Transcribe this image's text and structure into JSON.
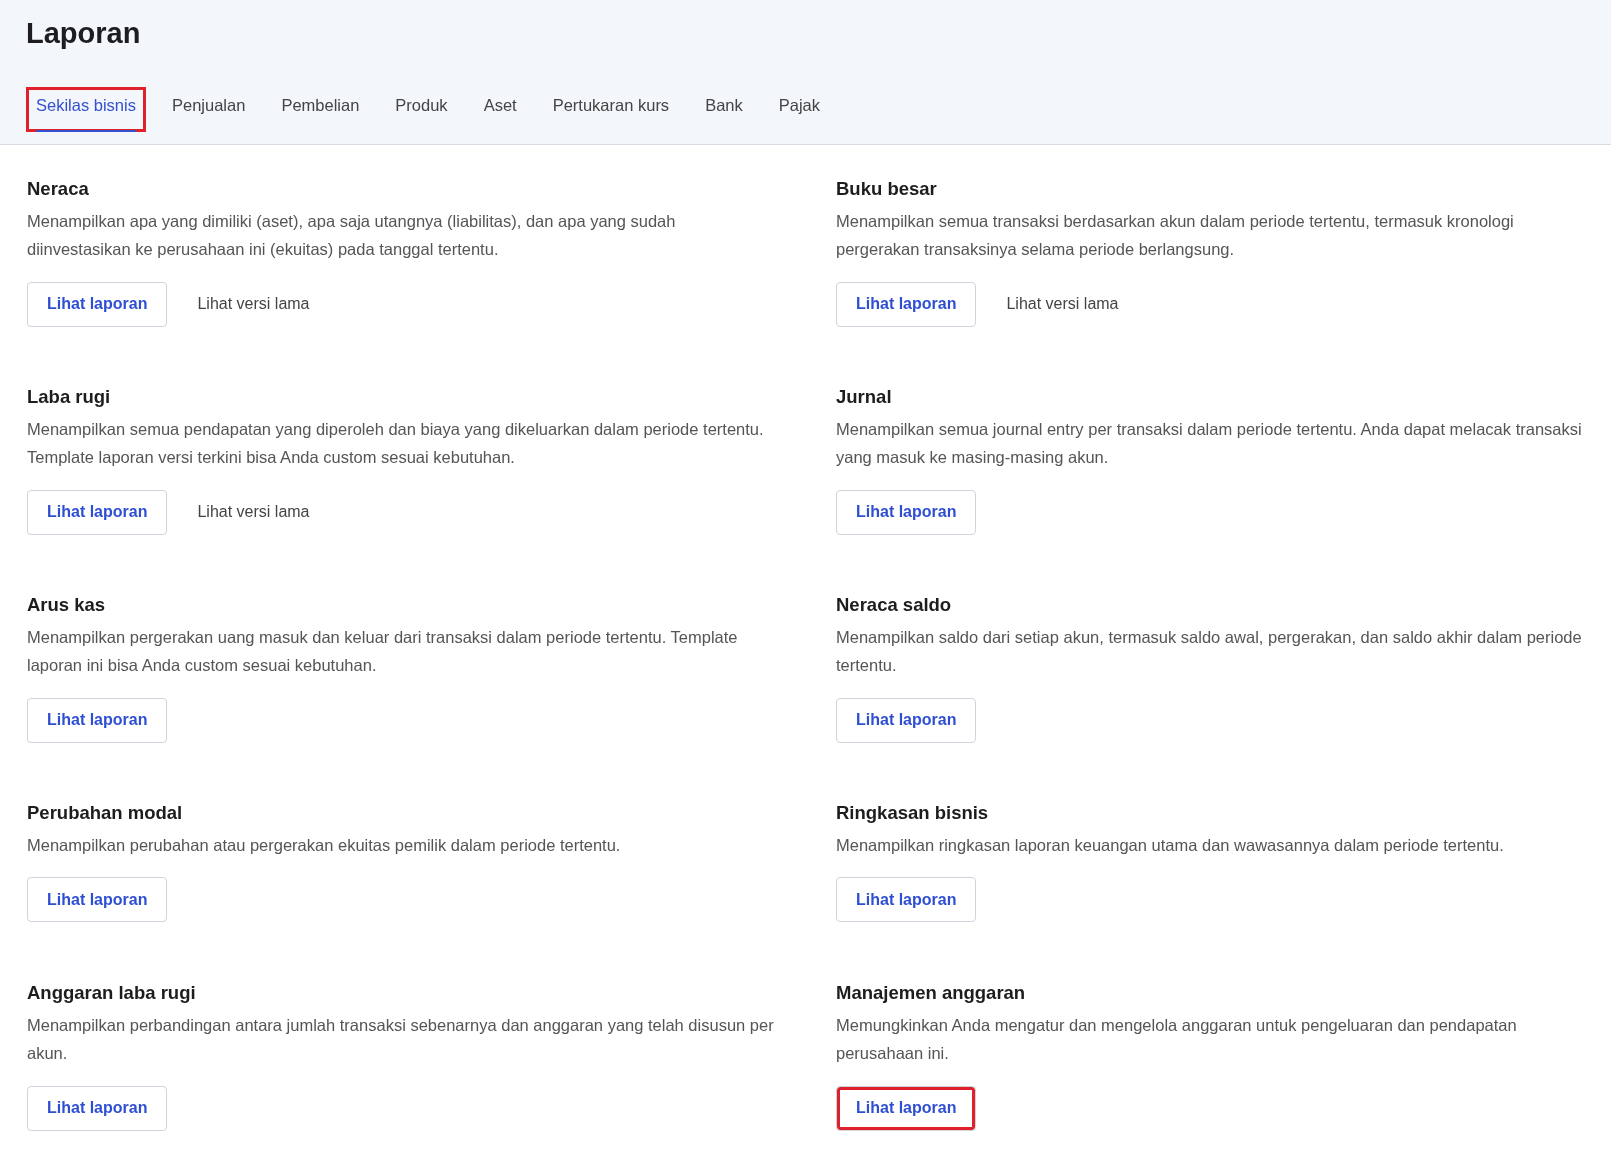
{
  "title": "Laporan",
  "tabs": [
    {
      "label": "Sekilas bisnis",
      "selected": true,
      "highlighted": true
    },
    {
      "label": "Penjualan",
      "selected": false,
      "highlighted": false
    },
    {
      "label": "Pembelian",
      "selected": false,
      "highlighted": false
    },
    {
      "label": "Produk",
      "selected": false,
      "highlighted": false
    },
    {
      "label": "Aset",
      "selected": false,
      "highlighted": false
    },
    {
      "label": "Pertukaran kurs",
      "selected": false,
      "highlighted": false
    },
    {
      "label": "Bank",
      "selected": false,
      "highlighted": false
    },
    {
      "label": "Pajak",
      "selected": false,
      "highlighted": false
    }
  ],
  "reports": [
    {
      "title": "Neraca",
      "description": "Menampilkan apa yang dimiliki (aset), apa saja utangnya (liabilitas), dan apa yang sudah diinvestasikan ke perusahaan ini (ekuitas) pada tanggal tertentu.",
      "view_button": {
        "label": "Lihat laporan",
        "highlighted": false
      },
      "legacy_link": "Lihat versi lama"
    },
    {
      "title": "Buku besar",
      "description": "Menampilkan semua transaksi berdasarkan akun dalam periode tertentu, termasuk kronologi pergerakan transaksinya selama periode berlangsung.",
      "view_button": {
        "label": "Lihat laporan",
        "highlighted": false
      },
      "legacy_link": "Lihat versi lama"
    },
    {
      "title": "Laba rugi",
      "description": "Menampilkan semua pendapatan yang diperoleh dan biaya yang dikeluarkan dalam periode tertentu. Template laporan versi terkini bisa Anda custom sesuai kebutuhan.",
      "view_button": {
        "label": "Lihat laporan",
        "highlighted": false
      },
      "legacy_link": "Lihat versi lama"
    },
    {
      "title": "Jurnal",
      "description": "Menampilkan semua journal entry per transaksi dalam periode tertentu. Anda dapat melacak transaksi yang masuk ke masing-masing akun.",
      "view_button": {
        "label": "Lihat laporan",
        "highlighted": false
      }
    },
    {
      "title": "Arus kas",
      "description": "Menampilkan pergerakan uang masuk dan keluar dari transaksi dalam periode tertentu. Template laporan ini bisa Anda custom sesuai kebutuhan.",
      "view_button": {
        "label": "Lihat laporan",
        "highlighted": false
      }
    },
    {
      "title": "Neraca saldo",
      "description": "Menampilkan saldo dari setiap akun, termasuk saldo awal, pergerakan, dan saldo akhir dalam periode tertentu.",
      "view_button": {
        "label": "Lihat laporan",
        "highlighted": false
      }
    },
    {
      "title": "Perubahan modal",
      "description": "Menampilkan perubahan atau pergerakan ekuitas pemilik dalam periode tertentu.",
      "view_button": {
        "label": "Lihat laporan",
        "highlighted": false
      }
    },
    {
      "title": "Ringkasan bisnis",
      "description": "Menampilkan ringkasan laporan keuangan utama dan wawasannya dalam periode tertentu.",
      "view_button": {
        "label": "Lihat laporan",
        "highlighted": false
      }
    },
    {
      "title": "Anggaran laba rugi",
      "description": "Menampilkan perbandingan antara jumlah transaksi sebenarnya dan anggaran yang telah disusun per akun.",
      "view_button": {
        "label": "Lihat laporan",
        "highlighted": false
      }
    },
    {
      "title": "Manajemen anggaran",
      "description": "Memungkinkan Anda mengatur dan mengelola anggaran untuk pengeluaran dan pendapatan perusahaan ini.",
      "view_button": {
        "label": "Lihat laporan",
        "highlighted": true
      }
    }
  ]
}
